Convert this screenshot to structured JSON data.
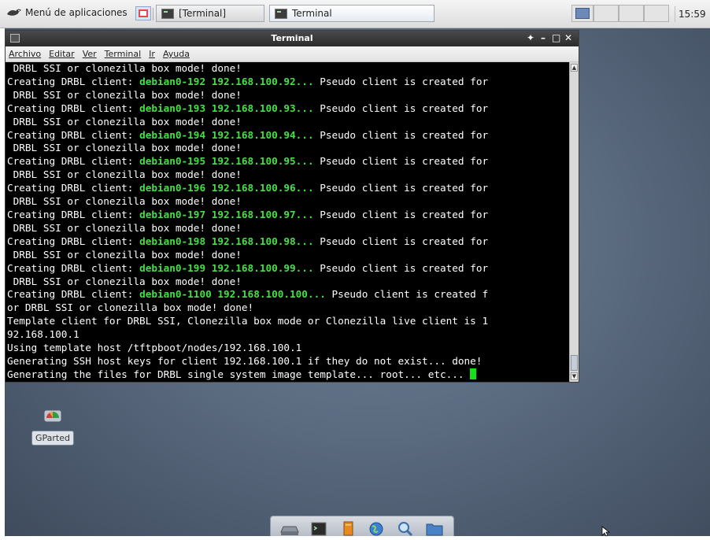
{
  "top_panel": {
    "app_menu_label": "Menú de aplicaciones",
    "tasks": [
      {
        "label": "[Terminal]"
      },
      {
        "label": "Terminal"
      }
    ],
    "clock": "15:59"
  },
  "terminal": {
    "title": "Terminal",
    "controls": {
      "pin": "✦",
      "minimize": "–",
      "maximize": "□",
      "close": "✕"
    },
    "menu": [
      "Archivo",
      "Editar",
      "Ver",
      "Terminal",
      "Ir",
      "Ayuda"
    ],
    "lines": [
      {
        "segments": [
          {
            "t": " DRBL SSI or clonezilla box mode! done!",
            "c": "w"
          }
        ]
      },
      {
        "segments": [
          {
            "t": "Creating DRBL client: ",
            "c": "w"
          },
          {
            "t": "debian0-192 192.168.100.92...",
            "c": "g"
          },
          {
            "t": " Pseudo client is created for",
            "c": "w"
          }
        ]
      },
      {
        "segments": [
          {
            "t": " DRBL SSI or clonezilla box mode! done!",
            "c": "w"
          }
        ]
      },
      {
        "segments": [
          {
            "t": "Creating DRBL client: ",
            "c": "w"
          },
          {
            "t": "debian0-193 192.168.100.93...",
            "c": "g"
          },
          {
            "t": " Pseudo client is created for",
            "c": "w"
          }
        ]
      },
      {
        "segments": [
          {
            "t": " DRBL SSI or clonezilla box mode! done!",
            "c": "w"
          }
        ]
      },
      {
        "segments": [
          {
            "t": "Creating DRBL client: ",
            "c": "w"
          },
          {
            "t": "debian0-194 192.168.100.94...",
            "c": "g"
          },
          {
            "t": " Pseudo client is created for",
            "c": "w"
          }
        ]
      },
      {
        "segments": [
          {
            "t": " DRBL SSI or clonezilla box mode! done!",
            "c": "w"
          }
        ]
      },
      {
        "segments": [
          {
            "t": "Creating DRBL client: ",
            "c": "w"
          },
          {
            "t": "debian0-195 192.168.100.95...",
            "c": "g"
          },
          {
            "t": " Pseudo client is created for",
            "c": "w"
          }
        ]
      },
      {
        "segments": [
          {
            "t": " DRBL SSI or clonezilla box mode! done!",
            "c": "w"
          }
        ]
      },
      {
        "segments": [
          {
            "t": "Creating DRBL client: ",
            "c": "w"
          },
          {
            "t": "debian0-196 192.168.100.96...",
            "c": "g"
          },
          {
            "t": " Pseudo client is created for",
            "c": "w"
          }
        ]
      },
      {
        "segments": [
          {
            "t": " DRBL SSI or clonezilla box mode! done!",
            "c": "w"
          }
        ]
      },
      {
        "segments": [
          {
            "t": "Creating DRBL client: ",
            "c": "w"
          },
          {
            "t": "debian0-197 192.168.100.97...",
            "c": "g"
          },
          {
            "t": " Pseudo client is created for",
            "c": "w"
          }
        ]
      },
      {
        "segments": [
          {
            "t": " DRBL SSI or clonezilla box mode! done!",
            "c": "w"
          }
        ]
      },
      {
        "segments": [
          {
            "t": "Creating DRBL client: ",
            "c": "w"
          },
          {
            "t": "debian0-198 192.168.100.98...",
            "c": "g"
          },
          {
            "t": " Pseudo client is created for",
            "c": "w"
          }
        ]
      },
      {
        "segments": [
          {
            "t": " DRBL SSI or clonezilla box mode! done!",
            "c": "w"
          }
        ]
      },
      {
        "segments": [
          {
            "t": "Creating DRBL client: ",
            "c": "w"
          },
          {
            "t": "debian0-199 192.168.100.99...",
            "c": "g"
          },
          {
            "t": " Pseudo client is created for",
            "c": "w"
          }
        ]
      },
      {
        "segments": [
          {
            "t": " DRBL SSI or clonezilla box mode! done!",
            "c": "w"
          }
        ]
      },
      {
        "segments": [
          {
            "t": "Creating DRBL client: ",
            "c": "w"
          },
          {
            "t": "debian0-1100 192.168.100.100...",
            "c": "g"
          },
          {
            "t": " Pseudo client is created f",
            "c": "w"
          }
        ]
      },
      {
        "segments": [
          {
            "t": "or DRBL SSI or clonezilla box mode! done!",
            "c": "w"
          }
        ]
      },
      {
        "segments": [
          {
            "t": "Template client for DRBL SSI, Clonezilla box mode or Clonezilla live client is 1",
            "c": "w"
          }
        ]
      },
      {
        "segments": [
          {
            "t": "92.168.100.1",
            "c": "w"
          }
        ]
      },
      {
        "segments": [
          {
            "t": "Using template host /tftpboot/nodes/192.168.100.1",
            "c": "w"
          }
        ]
      },
      {
        "segments": [
          {
            "t": "Generating SSH host keys for client 192.168.100.1 if they do not exist... done!",
            "c": "w"
          }
        ]
      },
      {
        "segments": [
          {
            "t": "Generating the files for DRBL single system image template... root... etc... ",
            "c": "w"
          }
        ],
        "cursor": true
      }
    ]
  },
  "desktop": {
    "icons": [
      {
        "label": "GParted",
        "icon": "gparted-icon"
      }
    ]
  },
  "dock": {
    "items": [
      {
        "icon": "drive-icon"
      },
      {
        "icon": "terminal-icon"
      },
      {
        "icon": "text-editor-icon"
      },
      {
        "icon": "web-browser-icon"
      },
      {
        "icon": "search-icon"
      },
      {
        "icon": "folder-icon"
      }
    ]
  },
  "colors": {
    "terminal_green": "#45e045",
    "terminal_bg": "#000000",
    "cursor": "#18e018"
  }
}
